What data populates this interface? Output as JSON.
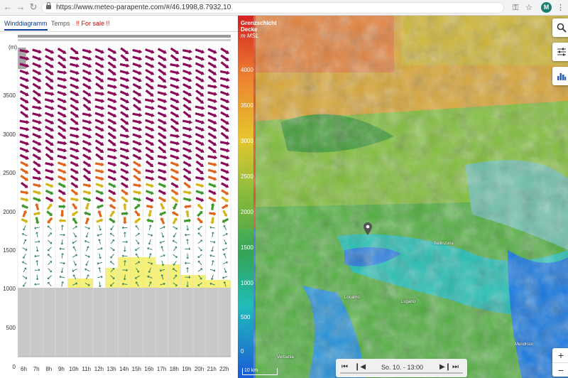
{
  "browser": {
    "url": "https://www.meteo-parapente.com/#/46.1998,8.7932,10",
    "avatar_letter": "M",
    "back_icon": "arrow-left-icon",
    "forward_icon": "arrow-right-icon",
    "reload_icon": "reload-icon",
    "key_icon": "key-icon",
    "star_icon": "star-icon",
    "menu_icon": "menu-dots-icon"
  },
  "tabs": [
    {
      "label": "Winddiagramm"
    },
    {
      "label": "Temps"
    },
    {
      "label": "!! For sale !!"
    }
  ],
  "chart": {
    "unit_label": "(m)",
    "y_ticks": [
      "3500",
      "3000",
      "2500",
      "2000",
      "1500",
      "1000",
      "500",
      "0"
    ],
    "x_ticks": [
      "6h",
      "7h",
      "8h",
      "9h",
      "10h",
      "11h",
      "12h",
      "13h",
      "14h",
      "15h",
      "16h",
      "17h",
      "18h",
      "19h",
      "20h",
      "21h",
      "22h"
    ],
    "thermal_highlight_color": "#f5f07a",
    "ground_color": "#c8c8c8"
  },
  "map": {
    "legend_title_line1": "Grenzschicht",
    "legend_title_line2": "Decke",
    "legend_unit": "m MSL",
    "legend_ticks": [
      "4000",
      "3500",
      "3000",
      "2500",
      "2000",
      "1500",
      "1000",
      "500",
      "0"
    ],
    "search_icon": "search-icon",
    "settings_icon": "sliders-icon",
    "chart_icon": "bar-chart-icon",
    "zoom_in": "+",
    "zoom_out": "−",
    "scale_label": "10 km",
    "places": [
      "Bellinzona",
      "Locarno",
      "Lugano",
      "Verbania",
      "Mendrisio"
    ]
  },
  "player": {
    "time_label": "So. 10. - 13:00",
    "first_icon": "skip-first-icon",
    "prev_icon": "step-back-icon",
    "next_icon": "step-forward-icon",
    "last_icon": "skip-last-icon"
  }
}
